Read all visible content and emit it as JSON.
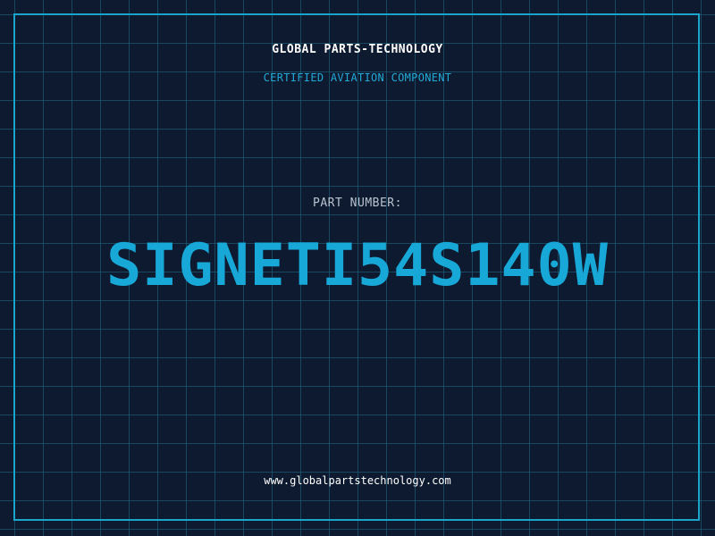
{
  "header": {
    "company": "GLOBAL PARTS-TECHNOLOGY",
    "subtitle": "CERTIFIED AVIATION COMPONENT"
  },
  "part": {
    "label": "PART NUMBER:",
    "number": "SIGNETI54S140W"
  },
  "footer": {
    "website": "www.globalpartstechnology.com"
  },
  "colors": {
    "background": "#0e1a2f",
    "grid": "#206e87",
    "accent": "#17a8d8",
    "frame": "#1aa6cc"
  }
}
